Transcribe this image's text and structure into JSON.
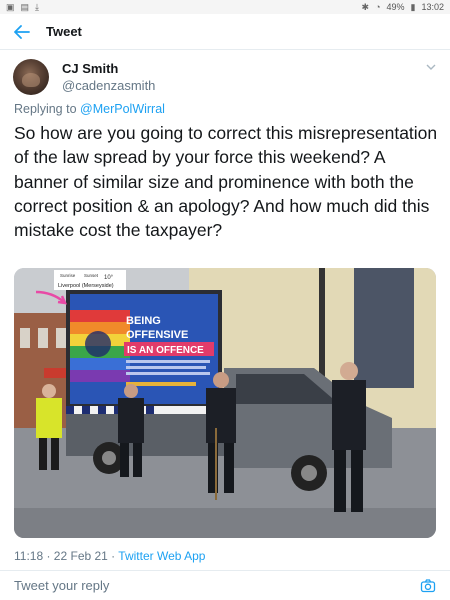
{
  "status_bar": {
    "battery": "49%",
    "time": "13:02",
    "icons": [
      "image-icon",
      "photo-icon",
      "download-icon",
      "bluetooth-icon",
      "wifi-icon",
      "battery-icon"
    ]
  },
  "nav": {
    "title": "Tweet",
    "back_icon": "arrow-left-icon"
  },
  "tweet": {
    "author_name": "CJ Smith",
    "author_handle": "@cadenzasmith",
    "replying_prefix": "Replying to",
    "replying_handle": "@MerPolWirral",
    "text": "So how are you going to correct this misrepresentation of the law spread by your force this weekend? A banner of similar size and prominence with both the correct position & an apology? And how much did this mistake cost the taxpayer?",
    "time": "11:18 · 22 Feb 21 · ",
    "app": "Twitter Web App"
  },
  "photo": {
    "billboard_line1": "BEING",
    "billboard_line2": "OFFENSIVE",
    "billboard_line3": "IS AN OFFENCE",
    "weather_sunrise": "Sunrise",
    "weather_sunset": "Sunset",
    "weather_temp": "10°",
    "weather_location": "Liverpool (Merseyside)"
  },
  "reply": {
    "placeholder": "Tweet your reply",
    "camera_icon": "camera-icon"
  },
  "colors": {
    "accent": "#1da1f2",
    "secondary_text": "#657786"
  }
}
